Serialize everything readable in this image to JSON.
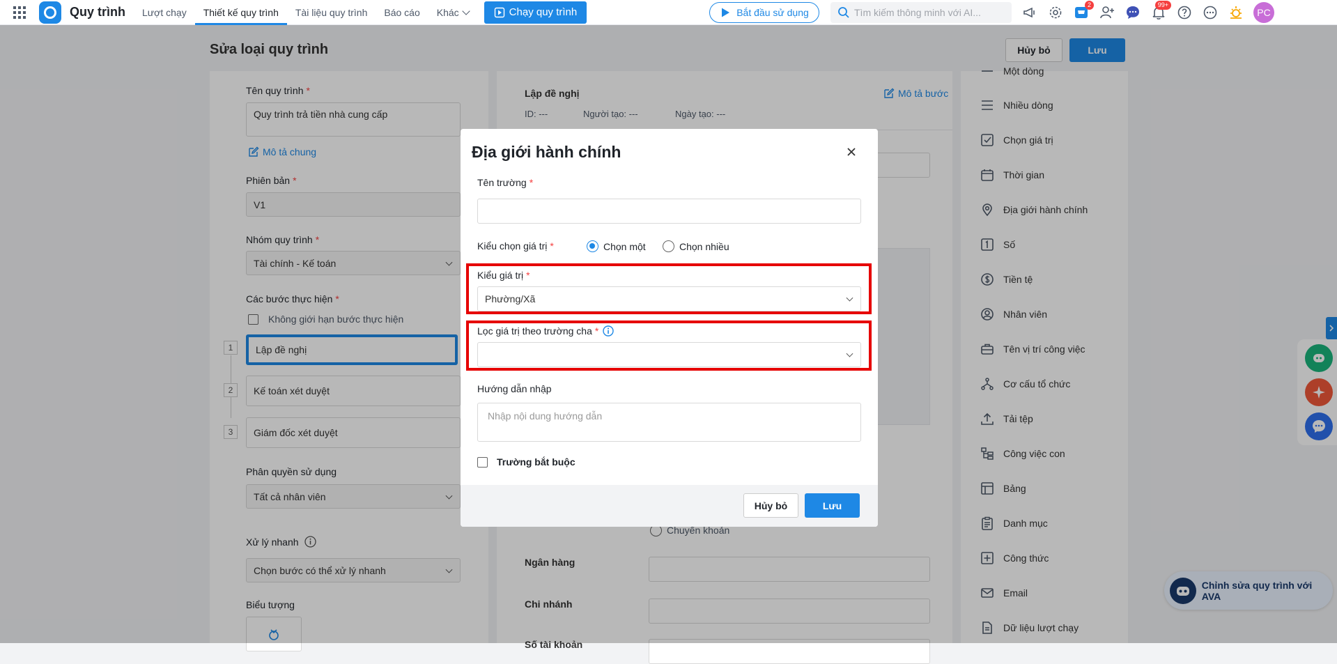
{
  "app": {
    "title": "Quy trình"
  },
  "nav": {
    "items": [
      "Lượt chạy",
      "Thiết kế quy trình",
      "Tài liệu quy trình",
      "Báo cáo",
      "Khác"
    ],
    "run_label": "Chạy quy trình"
  },
  "topbar": {
    "start_label": "Bắt đầu sử dụng",
    "search_placeholder": "Tìm kiếm thông minh với AI...",
    "cart_badge": "2",
    "bell_badge": "99+",
    "avatar": "PC"
  },
  "page": {
    "title": "Sửa loại quy trình",
    "cancel": "Hủy bỏ",
    "save": "Lưu"
  },
  "left": {
    "name_label": "Tên quy trình",
    "name_value": "Quy trình trả tiền nhà cung cấp",
    "desc_link": "Mô tả chung",
    "version_label": "Phiên bản",
    "version_value": "V1",
    "group_label": "Nhóm quy trình",
    "group_value": "Tài chính - Kế toán",
    "steps_label": "Các bước thực hiện",
    "unlimited_label": "Không giới hạn bước thực hiện",
    "steps": [
      {
        "num": "1",
        "label": "Lập đề nghị"
      },
      {
        "num": "2",
        "label": "Kế toán xét duyệt"
      },
      {
        "num": "3",
        "label": "Giám đốc xét duyệt"
      }
    ],
    "perm_label": "Phân quyền sử dụng",
    "perm_value": "Tất cả nhân viên",
    "quick_label": "Xử lý nhanh",
    "quick_value": "Chọn bước có thể xử lý nhanh",
    "icon_label": "Biểu tượng"
  },
  "middle": {
    "step_title": "Lập đề nghị",
    "step_desc_link": "Mô tả bước",
    "id_label": "ID: ---",
    "creator_label": "Người tạo: ---",
    "date_label": "Ngày tạo: ---",
    "transfer_label": "Chuyển khoản",
    "bank_label": "Ngân hàng",
    "branch_label": "Chi nhánh",
    "account_label": "Số tài khoản"
  },
  "sidebar": {
    "items": [
      "Một dòng",
      "Nhiều dòng",
      "Chọn giá trị",
      "Thời gian",
      "Địa giới hành chính",
      "Số",
      "Tiền tệ",
      "Nhân viên",
      "Tên vị trí công việc",
      "Cơ cấu tổ chức",
      "Tải tệp",
      "Công việc con",
      "Bảng",
      "Danh mục",
      "Công thức",
      "Email",
      "Dữ liệu lượt chạy"
    ]
  },
  "modal": {
    "title": "Địa giới hành chính",
    "field_name_label": "Tên trường",
    "field_name_value": "",
    "select_mode_label": "Kiểu chọn giá trị",
    "option_single": "Chọn một",
    "option_multi": "Chọn nhiều",
    "value_type_label": "Kiểu giá trị",
    "value_type_value": "Phường/Xã",
    "filter_label": "Lọc giá trị theo trường cha",
    "filter_value": "",
    "guide_label": "Hướng dẫn nhập",
    "guide_placeholder": "Nhập nội dung hướng dẫn",
    "required_label": "Trường bắt buộc",
    "cancel": "Hủy bỏ",
    "save": "Lưu"
  },
  "ava": {
    "label": "Chỉnh sửa quy trình với AVA"
  },
  "colors": {
    "accent": "#1e88e5",
    "highlight": "#e60000"
  }
}
